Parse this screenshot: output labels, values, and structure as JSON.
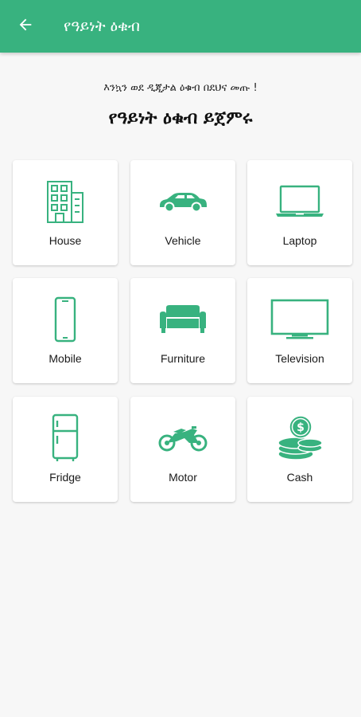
{
  "appbar": {
    "title": "የዓይነት ዕቁብ",
    "back_icon": "arrow-left-icon"
  },
  "intro": {
    "welcome": "እንኳን ወደ ዲጂታል ዕቁብ በደህና መጡ !",
    "headline": "የዓይነት ዕቁብ ይጀምሩ"
  },
  "theme": {
    "accent": "#38b27f",
    "background": "#f7f7f7",
    "card": "#ffffff"
  },
  "categories": [
    {
      "label": "House",
      "icon": "building-icon"
    },
    {
      "label": "Vehicle",
      "icon": "car-icon"
    },
    {
      "label": "Laptop",
      "icon": "laptop-icon"
    },
    {
      "label": "Mobile",
      "icon": "mobile-phone-icon"
    },
    {
      "label": "Furniture",
      "icon": "sofa-icon"
    },
    {
      "label": "Television",
      "icon": "television-icon"
    },
    {
      "label": "Fridge",
      "icon": "fridge-icon"
    },
    {
      "label": "Motor",
      "icon": "motorcycle-icon"
    },
    {
      "label": "Cash",
      "icon": "coins-icon"
    }
  ]
}
